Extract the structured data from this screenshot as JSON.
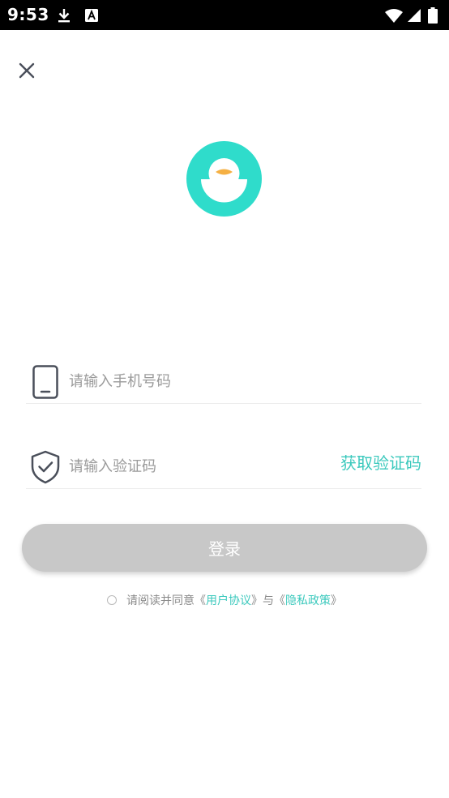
{
  "status_bar": {
    "time": "9:53",
    "icons": [
      "download-icon",
      "a-box-icon",
      "wifi-icon",
      "signal-icon",
      "battery-icon"
    ]
  },
  "close_icon": "close-icon",
  "logo_icon": "chick-logo-icon",
  "phone": {
    "icon": "phone-icon",
    "placeholder": "请输入手机号码",
    "value": ""
  },
  "code": {
    "icon": "shield-check-icon",
    "placeholder": "请输入验证码",
    "value": "",
    "get_code_label": "获取验证码"
  },
  "login_label": "登录",
  "agreement": {
    "prefix": "请阅读并同意",
    "open_quote": "《",
    "close_quote": "》",
    "user_agreement": "用户协议",
    "conjunction": "与",
    "privacy_policy": "隐私政策",
    "checked": false
  },
  "colors": {
    "accent": "#3cc9bd",
    "logo_teal": "#2fdccb",
    "beak": "#f5b043",
    "button_disabled": "#c8c8c8",
    "placeholder_text": "#9a9a9a",
    "icon_gray": "#4a4f5a"
  }
}
